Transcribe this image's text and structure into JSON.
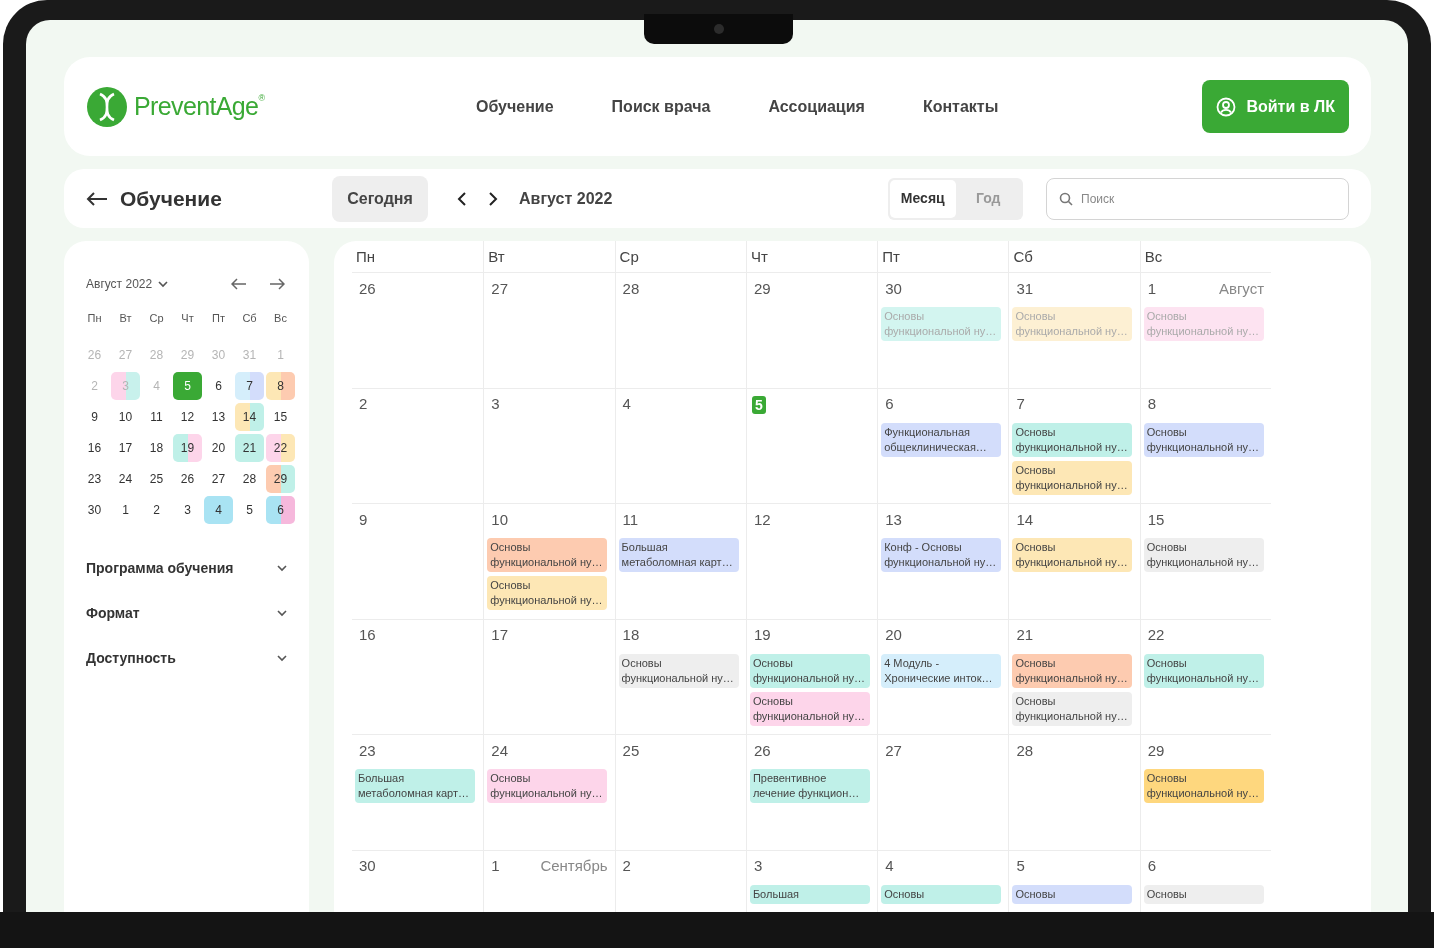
{
  "header": {
    "logo_text": "PreventAge",
    "logo_mark": "®",
    "nav": [
      "Обучение",
      "Поиск врача",
      "Ассоциация",
      "Контакты"
    ],
    "login_button": "Войти в ЛК"
  },
  "toolbar": {
    "title": "Обучение",
    "today_button": "Сегодня",
    "period": "Август 2022",
    "views": [
      {
        "label": "Месяц",
        "selected": true
      },
      {
        "label": "Год",
        "selected": false
      }
    ],
    "search": {
      "placeholder": "Поиск"
    }
  },
  "mini_calendar": {
    "month": "Август 2022",
    "weekdays": [
      "Пн",
      "Вт",
      "Ср",
      "Чт",
      "Пт",
      "Сб",
      "Вс"
    ],
    "days": [
      {
        "text": "26",
        "muted": true,
        "selected": false
      },
      {
        "text": "27",
        "muted": true,
        "selected": false
      },
      {
        "text": "28",
        "muted": true,
        "selected": false
      },
      {
        "text": "29",
        "muted": true,
        "selected": false
      },
      {
        "text": "30",
        "muted": true,
        "selected": false
      },
      {
        "text": "31",
        "muted": true,
        "selected": false
      },
      {
        "text": "1",
        "muted": true,
        "selected": false
      },
      {
        "text": "2",
        "muted": true,
        "selected": false
      },
      {
        "text": "3",
        "muted": true,
        "selected": false,
        "markers": [
          {
            "color": "#fdd5ea"
          },
          {
            "color": "#c8f1ec"
          }
        ]
      },
      {
        "text": "4",
        "muted": true,
        "selected": false
      },
      {
        "text": "5",
        "muted": false,
        "selected": true
      },
      {
        "text": "6",
        "muted": false,
        "selected": false
      },
      {
        "text": "7",
        "muted": false,
        "selected": false,
        "markers": [
          {
            "color": "#d5eefb"
          },
          {
            "color": "#d3ddfb"
          }
        ]
      },
      {
        "text": "8",
        "muted": false,
        "selected": false,
        "markers": [
          {
            "color": "#fde7b5"
          },
          {
            "color": "#fdcbb0"
          }
        ]
      },
      {
        "text": "9",
        "muted": false,
        "selected": false
      },
      {
        "text": "10",
        "muted": false,
        "selected": false
      },
      {
        "text": "11",
        "muted": false,
        "selected": false
      },
      {
        "text": "12",
        "muted": false,
        "selected": false
      },
      {
        "text": "13",
        "muted": false,
        "selected": false
      },
      {
        "text": "14",
        "muted": false,
        "selected": false,
        "markers": [
          {
            "color": "#fde7b5"
          },
          {
            "color": "#bff0e8"
          }
        ]
      },
      {
        "text": "15",
        "muted": false,
        "selected": false
      },
      {
        "text": "16",
        "muted": false,
        "selected": false
      },
      {
        "text": "17",
        "muted": false,
        "selected": false
      },
      {
        "text": "18",
        "muted": false,
        "selected": false
      },
      {
        "text": "19",
        "muted": false,
        "selected": false,
        "markers": [
          {
            "color": "#bff0e8"
          },
          {
            "color": "#fdd5ea"
          }
        ]
      },
      {
        "text": "20",
        "muted": false,
        "selected": false
      },
      {
        "text": "21",
        "muted": false,
        "selected": false,
        "markers": [
          {
            "color": "#bff0e8"
          },
          {
            "color": "#bff0e8"
          }
        ]
      },
      {
        "text": "22",
        "muted": false,
        "selected": false,
        "markers": [
          {
            "color": "#fdd5ea"
          },
          {
            "color": "#fde7b5"
          }
        ]
      },
      {
        "text": "23",
        "muted": false,
        "selected": false
      },
      {
        "text": "24",
        "muted": false,
        "selected": false
      },
      {
        "text": "25",
        "muted": false,
        "selected": false
      },
      {
        "text": "26",
        "muted": false,
        "selected": false
      },
      {
        "text": "27",
        "muted": false,
        "selected": false
      },
      {
        "text": "28",
        "muted": false,
        "selected": false
      },
      {
        "text": "29",
        "muted": false,
        "selected": false,
        "markers": [
          {
            "color": "#fdcbb0"
          },
          {
            "color": "#bff0e8"
          }
        ]
      },
      {
        "text": "30",
        "muted": false,
        "selected": false
      },
      {
        "text": "1",
        "muted": false,
        "selected": false
      },
      {
        "text": "2",
        "muted": false,
        "selected": false
      },
      {
        "text": "3",
        "muted": false,
        "selected": false
      },
      {
        "text": "4",
        "muted": false,
        "selected": false,
        "markers": [
          {
            "color": "#a9e3f3"
          },
          {
            "color": "#a9e3f3"
          }
        ]
      },
      {
        "text": "5",
        "muted": false,
        "selected": false
      },
      {
        "text": "6",
        "muted": false,
        "selected": false,
        "markers": [
          {
            "color": "#a9e3f3"
          },
          {
            "color": "#f6b8dc"
          }
        ]
      }
    ]
  },
  "filters": [
    {
      "label": "Программа обучения",
      "expanded": false
    },
    {
      "label": "Формат",
      "expanded": false
    },
    {
      "label": "Доступность",
      "expanded": false
    }
  ],
  "calendar": {
    "weekdays": [
      "Пн",
      "Вт",
      "Ср",
      "Чт",
      "Пт",
      "Сб",
      "Вс"
    ],
    "weeks": [
      [
        {
          "day": "26"
        },
        {
          "day": "27"
        },
        {
          "day": "28"
        },
        {
          "day": "29"
        },
        {
          "day": "30",
          "events": [
            {
              "title": "Основы функциональной ну…",
              "color": "#d3f5f0",
              "faded": true
            }
          ]
        },
        {
          "day": "31",
          "events": [
            {
              "title": "Основы функциональной ну…",
              "color": "#fdf0d3",
              "faded": true
            }
          ]
        },
        {
          "day": "1",
          "month": "Август",
          "events": [
            {
              "title": "Основы функциональной ну…",
              "color": "#fde3f1",
              "faded": true
            }
          ]
        }
      ],
      [
        {
          "day": "2"
        },
        {
          "day": "3"
        },
        {
          "day": "4"
        },
        {
          "day": "5",
          "today": true
        },
        {
          "day": "6",
          "events": [
            {
              "title": "Функциональная общеклиническая…",
              "color": "#d3ddfb",
              "faded": false
            }
          ]
        },
        {
          "day": "7",
          "events": [
            {
              "title": "Основы функциональной ну…",
              "color": "#bff0e8",
              "faded": false
            },
            {
              "title": "Основы функциональной ну…",
              "color": "#fde7b5",
              "faded": false
            }
          ]
        },
        {
          "day": "8",
          "events": [
            {
              "title": "Основы функциональной ну…",
              "color": "#d3ddfb",
              "faded": false
            }
          ]
        }
      ],
      [
        {
          "day": "9"
        },
        {
          "day": "10",
          "events": [
            {
              "title": "Основы функциональной ну…",
              "color": "#fdcbb0",
              "faded": false
            },
            {
              "title": "Основы функциональной ну…",
              "color": "#fde7b5",
              "faded": false
            }
          ]
        },
        {
          "day": "11",
          "events": [
            {
              "title": "Большая метаболомная карт…",
              "color": "#d3ddfb",
              "faded": false
            }
          ]
        },
        {
          "day": "12"
        },
        {
          "day": "13",
          "events": [
            {
              "title": "Конф - Основы функциональной ну…",
              "color": "#d3ddfb",
              "faded": false
            }
          ]
        },
        {
          "day": "14",
          "events": [
            {
              "title": "Основы функциональной ну…",
              "color": "#fde7b5",
              "faded": false
            }
          ]
        },
        {
          "day": "15",
          "events": [
            {
              "title": "Основы функциональной ну…",
              "color": "#eeeeee",
              "faded": false
            }
          ]
        }
      ],
      [
        {
          "day": "16"
        },
        {
          "day": "17"
        },
        {
          "day": "18",
          "events": [
            {
              "title": "Основы функциональной ну…",
              "color": "#eeeeee",
              "faded": false
            }
          ]
        },
        {
          "day": "19",
          "events": [
            {
              "title": "Основы функциональной ну…",
              "color": "#bff0e8",
              "faded": false
            },
            {
              "title": "Основы функциональной ну…",
              "color": "#fdd5ea",
              "faded": false
            }
          ]
        },
        {
          "day": "20",
          "events": [
            {
              "title": "4 Модуль - Хронические инток…",
              "color": "#d5eefb",
              "faded": false
            }
          ]
        },
        {
          "day": "21",
          "events": [
            {
              "title": "Основы функциональной ну…",
              "color": "#fdcbb0",
              "faded": false
            },
            {
              "title": "Основы функциональной ну…",
              "color": "#eeeeee",
              "faded": false
            }
          ]
        },
        {
          "day": "22",
          "events": [
            {
              "title": "Основы функциональной ну…",
              "color": "#bff0e8",
              "faded": false
            }
          ]
        }
      ],
      [
        {
          "day": "23",
          "events": [
            {
              "title": "Большая метаболомная карт…",
              "color": "#bff0e8",
              "faded": false
            }
          ]
        },
        {
          "day": "24",
          "events": [
            {
              "title": "Основы функциональной ну…",
              "color": "#fdd5ea",
              "faded": false
            }
          ]
        },
        {
          "day": "25"
        },
        {
          "day": "26",
          "events": [
            {
              "title": "Превентивное лечение функцион…",
              "color": "#bff0e8",
              "faded": false
            }
          ]
        },
        {
          "day": "27"
        },
        {
          "day": "28"
        },
        {
          "day": "29",
          "events": [
            {
              "title": "Основы функциональной ну…",
              "color": "#fed77e",
              "faded": false
            }
          ]
        }
      ],
      [
        {
          "day": "30"
        },
        {
          "day": "1",
          "month": "Сентябрь"
        },
        {
          "day": "2"
        },
        {
          "day": "3",
          "events": [
            {
              "title": "Большая",
              "color": "#bff0e8",
              "faded": false
            }
          ]
        },
        {
          "day": "4",
          "events": [
            {
              "title": "Основы",
              "color": "#bff0e8",
              "faded": false
            }
          ]
        },
        {
          "day": "5",
          "events": [
            {
              "title": "Основы",
              "color": "#d3ddfb",
              "faded": false
            }
          ]
        },
        {
          "day": "6",
          "events": [
            {
              "title": "Основы",
              "color": "#eeeeee",
              "faded": false
            }
          ]
        }
      ]
    ]
  }
}
